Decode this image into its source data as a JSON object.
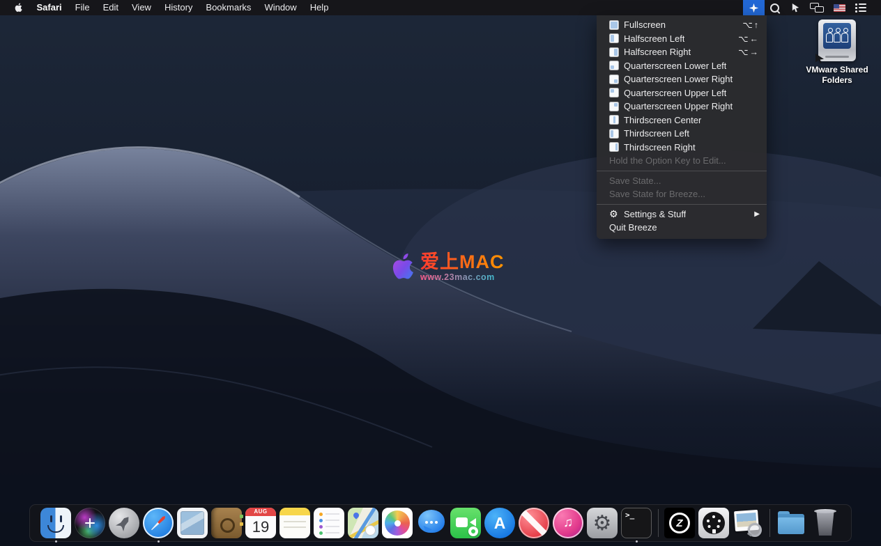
{
  "colors": {
    "menubar_bg": "#161619",
    "menubar_selection_blue": "#2268d6",
    "menu_bg": "#2b2b2e",
    "menu_text": "#ededee",
    "menu_disabled_text": "#737376",
    "menu_region_icon_blue": "#a9c7e8",
    "dock_bg": "rgba(22,22,26,0.7)",
    "wallpaper_dark": "#0d1422",
    "wallpaper_dune_highlight": "#b8c0d2"
  },
  "menu_bar": {
    "app_name": "Safari",
    "menus": [
      "File",
      "Edit",
      "View",
      "History",
      "Bookmarks",
      "Window",
      "Help"
    ],
    "status_icons": [
      "breeze-star",
      "spotlight-search",
      "pointer",
      "displays",
      "us-flag-input",
      "notification-list"
    ]
  },
  "breeze_menu": {
    "items": [
      {
        "label": "Fullscreen",
        "shortcut": "⌥↑",
        "region": "full"
      },
      {
        "label": "Halfscreen Left",
        "shortcut": "⌥←",
        "region": "half-left"
      },
      {
        "label": "Halfscreen Right",
        "shortcut": "⌥→",
        "region": "half-right"
      },
      {
        "label": "Quarterscreen Lower Left",
        "region": "quarter-lower-left"
      },
      {
        "label": "Quarterscreen Lower Right",
        "region": "quarter-lower-right"
      },
      {
        "label": "Quarterscreen Upper Left",
        "region": "quarter-upper-left"
      },
      {
        "label": "Quarterscreen Upper Right",
        "region": "quarter-upper-right"
      },
      {
        "label": "Thirdscreen Center",
        "region": "third-center"
      },
      {
        "label": "Thirdscreen Left",
        "region": "third-left"
      },
      {
        "label": "Thirdscreen Right",
        "region": "third-right"
      },
      {
        "label": "Hold the Option Key to Edit...",
        "disabled": true
      },
      {
        "label": "Save State...",
        "disabled": true
      },
      {
        "label": "Save State for Breeze...",
        "disabled": true
      },
      {
        "label": "Settings & Stuff",
        "has_submenu": true
      },
      {
        "label": "Quit Breeze"
      }
    ],
    "gear_glyph": "⚙",
    "submenu_arrow": "▶"
  },
  "desktop": {
    "icons": [
      {
        "label": "VMware Shared Folders"
      }
    ],
    "watermark": {
      "title": "爱上MAC",
      "subtitle": "www.23mac.com"
    }
  },
  "dock": {
    "items": [
      {
        "name": "finder",
        "running": true
      },
      {
        "name": "siri"
      },
      {
        "name": "launchpad"
      },
      {
        "name": "safari",
        "running": true
      },
      {
        "name": "mail"
      },
      {
        "name": "contacts"
      },
      {
        "name": "calendar"
      },
      {
        "name": "notes"
      },
      {
        "name": "reminders"
      },
      {
        "name": "maps"
      },
      {
        "name": "photos"
      },
      {
        "name": "messages"
      },
      {
        "name": "facetime"
      },
      {
        "name": "app-store"
      },
      {
        "name": "news"
      },
      {
        "name": "itunes"
      },
      {
        "name": "system-preferences"
      },
      {
        "name": "terminal",
        "running": true
      },
      {
        "divider": true
      },
      {
        "name": "breeze"
      },
      {
        "name": "midi-device"
      },
      {
        "name": "preview"
      },
      {
        "divider": true
      },
      {
        "name": "downloads-folder"
      },
      {
        "name": "trash"
      }
    ],
    "glyphs": {
      "calendar_month": "AUG",
      "calendar_day": "19",
      "terminal_prompt": ">_",
      "app_store_letter": "A",
      "itunes_note": "♫",
      "breeze_letter": "Z",
      "gear": "⚙"
    }
  }
}
